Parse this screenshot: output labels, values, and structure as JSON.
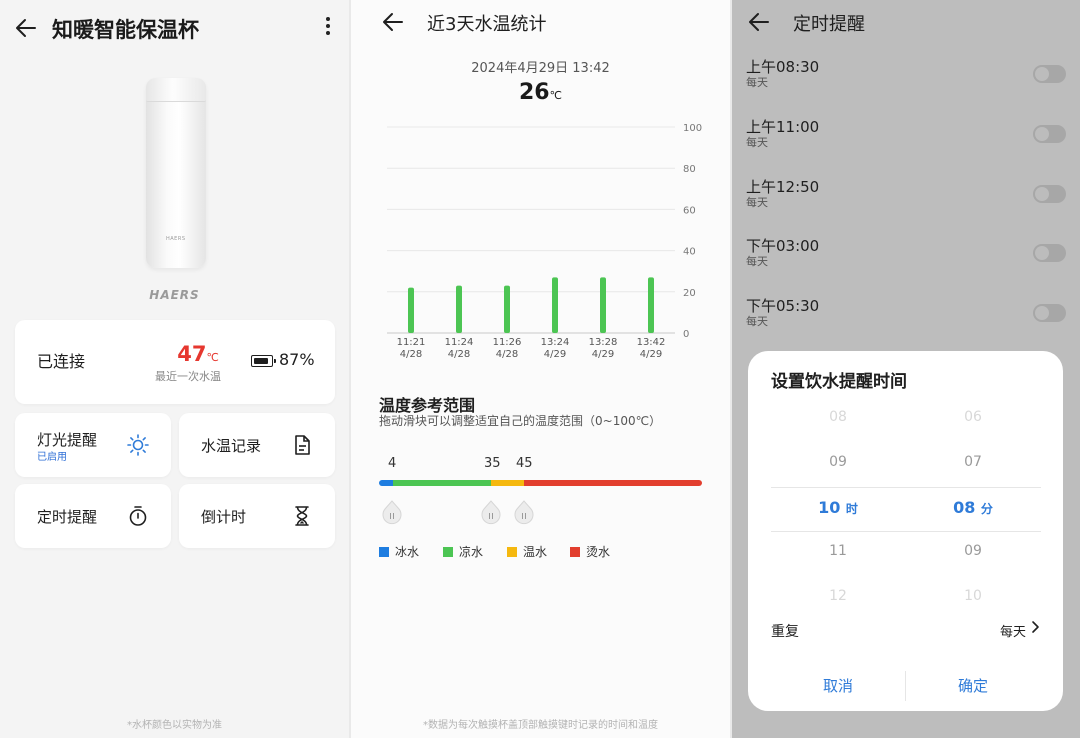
{
  "colors": {
    "accent": "#2f7bd8",
    "temp_red": "#e6372f",
    "bar_green": "#4cc553",
    "ice": "#1e7de0",
    "cool": "#4cc553",
    "warm": "#f5b80f",
    "hot": "#e23e2e"
  },
  "panel1": {
    "title": "知暖智能保温杯",
    "brand": "HAERS",
    "cup_mark": "HAERS",
    "status": {
      "connection": "已连接",
      "temp_value": "47",
      "temp_unit": "℃",
      "temp_caption": "最近一次水温",
      "battery": "87%"
    },
    "tiles": [
      {
        "title": "灯光提醒",
        "sub": "已启用",
        "icon": "sun-icon"
      },
      {
        "title": "水温记录",
        "icon": "document-icon"
      },
      {
        "title": "定时提醒",
        "icon": "stopwatch-icon"
      },
      {
        "title": "倒计时",
        "icon": "hourglass-icon"
      }
    ],
    "footnote": "*水杯颜色以实物为准"
  },
  "panel2": {
    "title": "近3天水温统计",
    "date": "2024年4月29日 13:42",
    "temp_value": "26",
    "temp_unit": "℃",
    "range_title": "温度参考范围",
    "range_sub": "拖动滑块可以调整适宜自己的温度范围（0~100℃）",
    "range_values": {
      "low": "4",
      "mid": "35",
      "high": "45"
    },
    "legend": [
      {
        "label": "冰水",
        "color": "#1e7de0"
      },
      {
        "label": "凉水",
        "color": "#4cc553"
      },
      {
        "label": "温水",
        "color": "#f5b80f"
      },
      {
        "label": "烫水",
        "color": "#e23e2e"
      }
    ],
    "footnote": "*数据为每次触摸杯盖顶部触摸键时记录的时间和温度"
  },
  "chart_data": {
    "type": "bar",
    "categories": [
      "11:21\n4/28",
      "11:24\n4/28",
      "11:26\n4/28",
      "13:24\n4/29",
      "13:28\n4/29",
      "13:42\n4/29"
    ],
    "times": [
      "11:21",
      "11:24",
      "11:26",
      "13:24",
      "13:28",
      "13:42"
    ],
    "dates": [
      "4/28",
      "4/28",
      "4/28",
      "4/29",
      "4/29",
      "4/29"
    ],
    "values": [
      22,
      23,
      23,
      27,
      27,
      27
    ],
    "yticks": [
      "100",
      "80",
      "60",
      "40",
      "20",
      "0"
    ],
    "ylim": [
      0,
      100
    ],
    "grid": true,
    "y_axis_side": "right"
  },
  "panel3": {
    "title": "定时提醒",
    "reminders": [
      {
        "time": "上午08:30",
        "repeat": "每天",
        "enabled": false
      },
      {
        "time": "上午11:00",
        "repeat": "每天",
        "enabled": false
      },
      {
        "time": "上午12:50",
        "repeat": "每天",
        "enabled": false
      },
      {
        "time": "下午03:00",
        "repeat": "每天",
        "enabled": false
      },
      {
        "time": "下午05:30",
        "repeat": "每天",
        "enabled": false
      }
    ],
    "dialog": {
      "title": "设置饮水提醒时间",
      "hours": [
        "08",
        "09",
        "10",
        "11",
        "12"
      ],
      "hour_selected": "10",
      "hour_suffix": "时",
      "minutes": [
        "06",
        "07",
        "08",
        "09",
        "10"
      ],
      "minute_selected": "08",
      "minute_suffix": "分",
      "repeat_label": "重复",
      "repeat_value": "每天",
      "cancel": "取消",
      "confirm": "确定"
    }
  }
}
